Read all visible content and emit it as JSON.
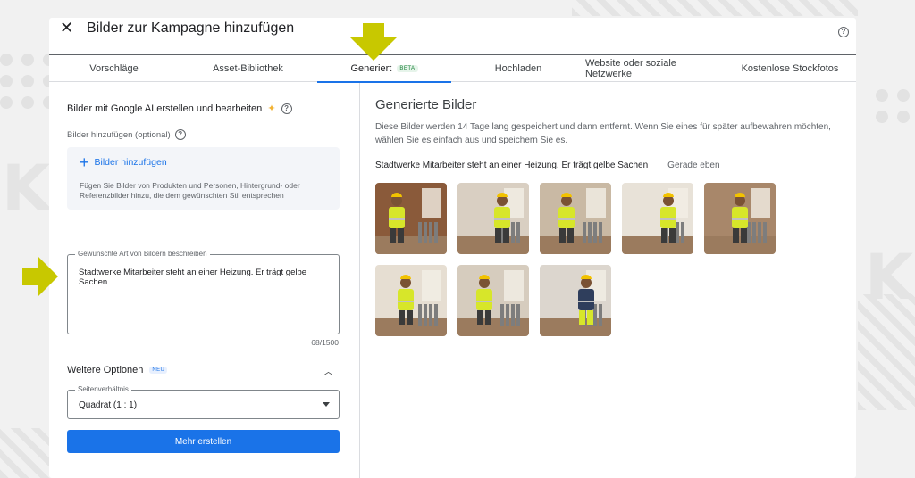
{
  "dialog": {
    "title": "Bilder zur Kampagne hinzufügen",
    "close_icon": "close-icon",
    "help_icon": "help-circle-icon"
  },
  "tabs": [
    {
      "label": "Vorschläge",
      "active": false
    },
    {
      "label": "Asset-Bibliothek",
      "active": false
    },
    {
      "label": "Generiert",
      "active": true,
      "badge": "BETA"
    },
    {
      "label": "Hochladen",
      "active": false
    },
    {
      "label": "Website oder soziale Netzwerke",
      "active": false
    },
    {
      "label": "Kostenlose Stockfotos",
      "active": false
    }
  ],
  "left": {
    "section_title": "Bilder mit Google AI erstellen und bearbeiten",
    "add_label": "Bilder hinzufügen (optional)",
    "add_button": "Bilder hinzufügen",
    "add_description": "Fügen Sie Bilder von Produkten und Personen, Hintergrund- oder Referenzbilder hinzu, die dem gewünschten Stil entsprechen",
    "textarea_label": "Gewünschte Art von Bildern beschreiben",
    "textarea_value": "Stadtwerke Mitarbeiter steht an einer Heizung. Er trägt gelbe Sachen",
    "counter": "68/1500",
    "more_options": "Weitere Optionen",
    "more_options_badge": "NEU",
    "aspect_label": "Seitenverhältnis",
    "aspect_value": "Quadrat (1 : 1)",
    "generate_button": "Mehr erstellen"
  },
  "right": {
    "title": "Generierte Bilder",
    "description": "Diese Bilder werden 14 Tage lang gespeichert und dann entfernt. Wenn Sie eines für später aufbewahren möchten, wählen Sie es einfach aus und speichern Sie es.",
    "prompt": "Stadtwerke Mitarbeiter steht an einer Heizung. Er trägt gelbe Sachen",
    "timestamp": "Gerade eben"
  },
  "colors": {
    "accent": "#1a73e8",
    "arrow": "#c8c800",
    "vest": "#d7e62a"
  }
}
